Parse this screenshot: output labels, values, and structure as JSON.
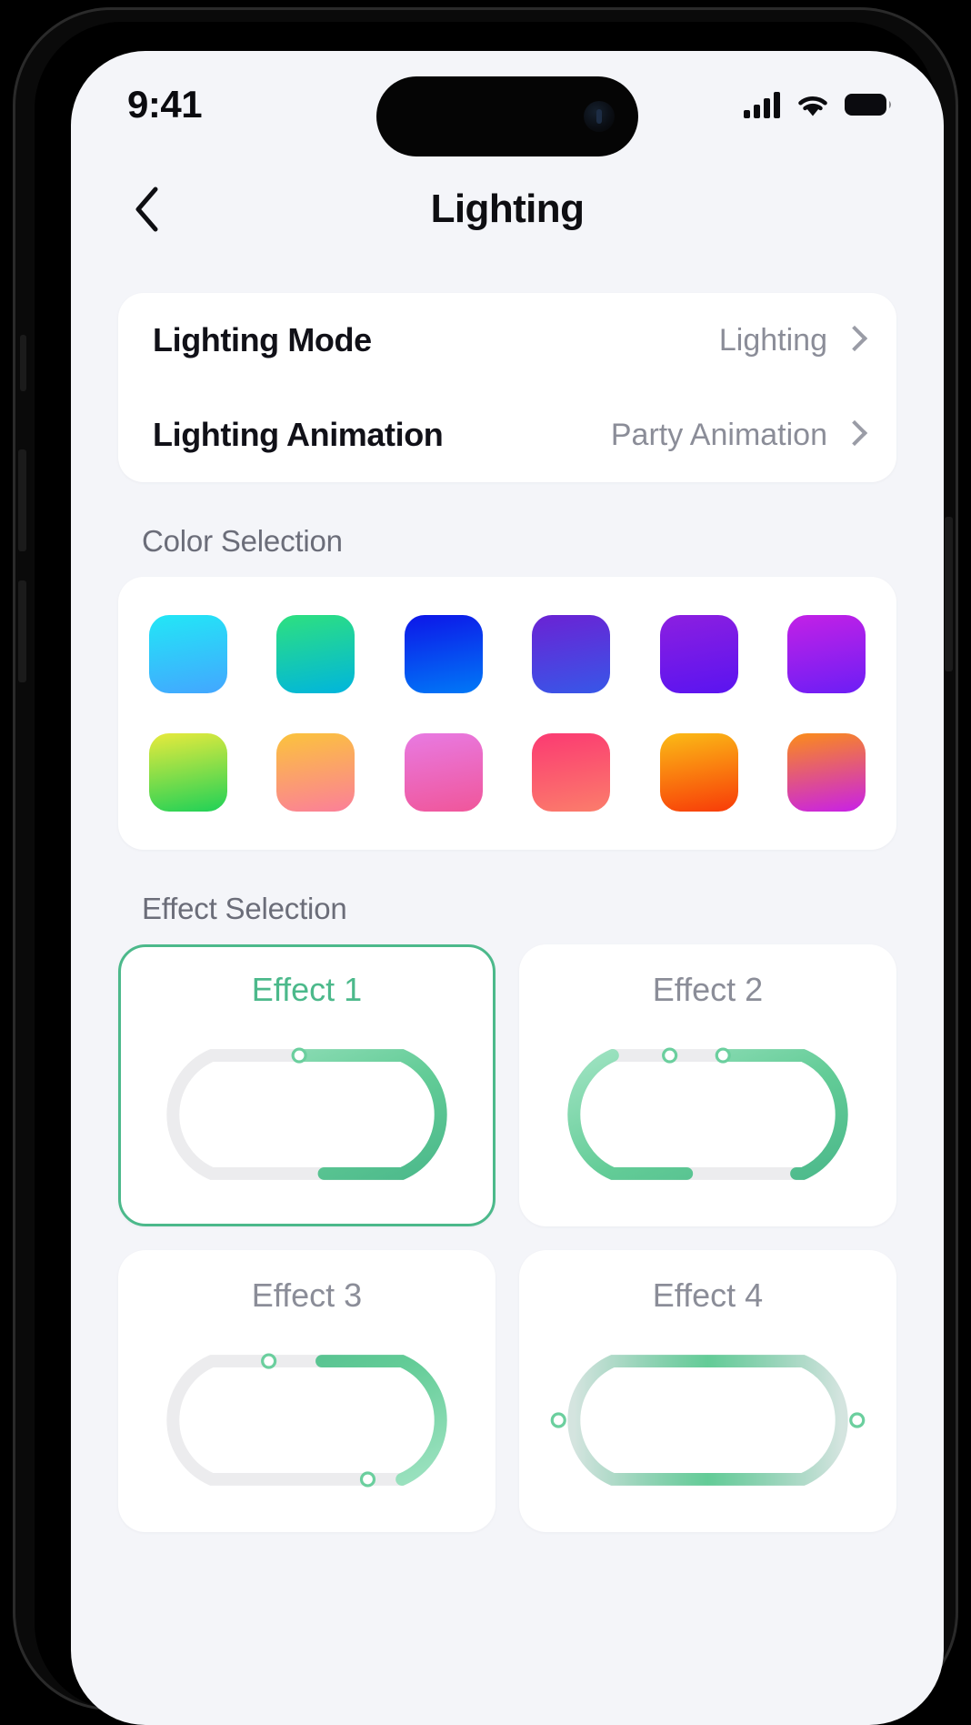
{
  "status_bar": {
    "time": "9:41",
    "cellular_icon": "signal-bars-icon",
    "wifi_icon": "wifi-icon",
    "battery_icon": "battery-full-icon"
  },
  "header": {
    "back_icon": "chevron-left-icon",
    "title": "Lighting"
  },
  "settings": {
    "rows": [
      {
        "label": "Lighting Mode",
        "value": "Lighting",
        "chevron_icon": "chevron-right-icon"
      },
      {
        "label": "Lighting Animation",
        "value": "Party Animation",
        "chevron_icon": "chevron-right-icon"
      }
    ]
  },
  "color_selection": {
    "title": "Color Selection",
    "rows": [
      [
        {
          "name": "cyan-blue",
          "from": "#22e7f6",
          "to": "#43a6ff"
        },
        {
          "name": "green-teal",
          "from": "#2ee07f",
          "to": "#00b5dd"
        },
        {
          "name": "blue-azure",
          "from": "#0d15e8",
          "to": "#0079f7"
        },
        {
          "name": "violet-blue",
          "from": "#6b22d4",
          "to": "#3757e8"
        },
        {
          "name": "purple-violet",
          "from": "#8c1fe0",
          "to": "#5a14f0"
        },
        {
          "name": "magenta-purple",
          "from": "#c321e6",
          "to": "#6c1ef5"
        }
      ],
      [
        {
          "name": "yellow-green",
          "from": "#e8ea3c",
          "to": "#1fd157"
        },
        {
          "name": "yellow-pink",
          "from": "#fbc33c",
          "to": "#fb7f99"
        },
        {
          "name": "orchid-pink",
          "from": "#e87ae2",
          "to": "#f0569a"
        },
        {
          "name": "rose-coral",
          "from": "#fb3a72",
          "to": "#fb7d6b"
        },
        {
          "name": "amber-orange",
          "from": "#fbbb16",
          "to": "#f83b08"
        },
        {
          "name": "orange-magenta",
          "from": "#fb8c19",
          "to": "#c820e8"
        }
      ]
    ]
  },
  "effect_selection": {
    "title": "Effect Selection",
    "effects": [
      {
        "label": "Effect 1",
        "selected": true,
        "pattern": "single-segment-top-right"
      },
      {
        "label": "Effect 2",
        "selected": false,
        "pattern": "dual-segment-split-top"
      },
      {
        "label": "Effect 3",
        "selected": false,
        "pattern": "diagonal-sweep"
      },
      {
        "label": "Effect 4",
        "selected": false,
        "pattern": "full-loop-dual-marker"
      }
    ]
  },
  "theme": {
    "accent": "#4cb98b",
    "background": "#f4f5f9",
    "card": "#ffffff",
    "text_primary": "#111118",
    "text_secondary": "#8b8d98",
    "track_idle": "#ececee"
  }
}
